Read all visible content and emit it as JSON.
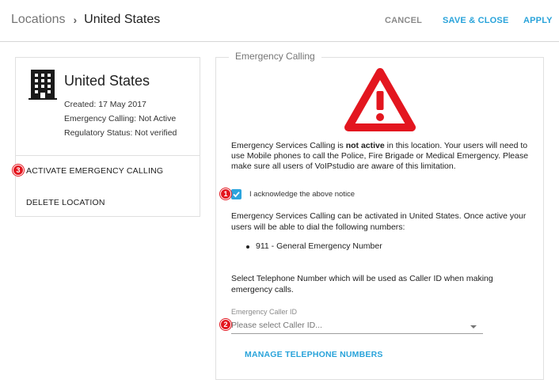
{
  "header": {
    "breadcrumb_root": "Locations",
    "breadcrumb_separator": "›",
    "breadcrumb_current": "United States",
    "cancel_label": "CANCEL",
    "save_close_label": "SAVE & CLOSE",
    "apply_label": "APPLY"
  },
  "location_card": {
    "icon": "building-icon",
    "name": "United States",
    "created": "Created: 17 May 2017",
    "emergency_calling": "Emergency Calling: Not Active",
    "regulatory_status": "Regulatory Status: Not verified",
    "activate_label": "ACTIVATE EMERGENCY CALLING",
    "delete_label": "DELETE LOCATION"
  },
  "badges": {
    "one": "1",
    "two": "2",
    "three": "3"
  },
  "emergency_panel": {
    "legend": "Emergency Calling",
    "warning_icon": "warning-triangle-icon",
    "warning_prefix": "Emergency Services Calling is ",
    "warning_bold": "not active",
    "warning_suffix": " in this location. Your users will need to use Mobile phones to call the Police, Fire Brigade or Medical Emergency. Please make sure all users of VoIPstudio are aware of this limitation.",
    "acknowledge_checked": true,
    "acknowledge_label": "I acknowledge the above notice",
    "activate_info": "Emergency Services Calling can be activated in United States. Once active your users will be able to dial the following numbers:",
    "numbers": [
      "911 - General Emergency Number"
    ],
    "select_info": "Select Telephone Number which will be used as Caller ID when making emergency calls.",
    "caller_id_label": "Emergency Caller ID",
    "caller_id_placeholder": "Please select Caller ID...",
    "manage_numbers_label": "MANAGE TELEPHONE NUMBERS"
  },
  "colors": {
    "accent": "#29a3da",
    "warning_red": "#e3161f",
    "checkbox": "#2ba4dd"
  }
}
